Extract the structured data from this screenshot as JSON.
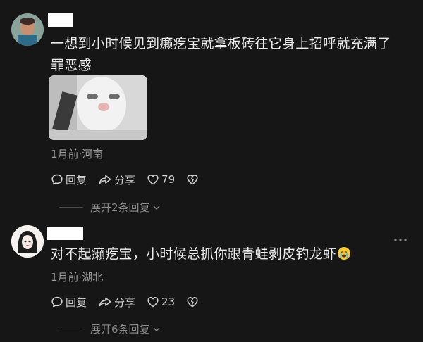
{
  "comments": [
    {
      "text": "一想到小时候见到癞疙宝就拿板砖往它身上招呼就充满了罪恶感",
      "meta": "1月前·河南",
      "reply_label": "回复",
      "share_label": "分享",
      "likes": "79",
      "expand_label": "展开2条回复"
    },
    {
      "text": "对不起癞疙宝，小时候总抓你跟青蛙剥皮钓龙虾",
      "emoji": "crying-face",
      "meta": "1月前·湖北",
      "reply_label": "回复",
      "share_label": "分享",
      "likes": "23",
      "expand_label": "展开6条回复"
    }
  ],
  "colors": {
    "background": "#161616",
    "text": "#ececec",
    "meta": "#9a9a9a",
    "icon": "#cfcfcf"
  }
}
